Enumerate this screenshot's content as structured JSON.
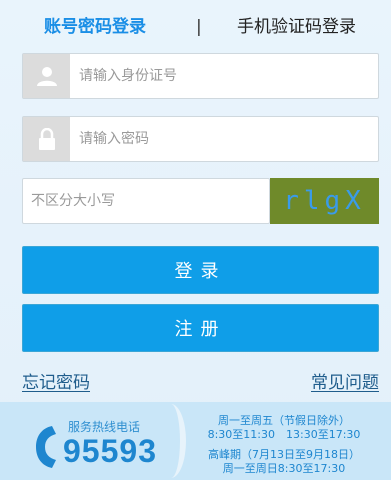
{
  "tabs": {
    "account": "账号密码登录",
    "separator": "|",
    "phone": "手机验证码登录"
  },
  "form": {
    "id_placeholder": "请输入身份证号",
    "password_placeholder": "请输入密码",
    "captcha_placeholder": "不区分大小写",
    "captcha_text": "rlgX"
  },
  "buttons": {
    "login": "登录",
    "register": "注册"
  },
  "links": {
    "forgot": "忘记密码",
    "faq": "常见问题"
  },
  "hotline": {
    "label": "服务热线电话",
    "number": "95593",
    "hours_line1": "周一至周五（节假日除外）",
    "hours_line2": "8:30至11:30　13:30至17:30",
    "hours_line3": "高峰期（7月13日至9月18日）",
    "hours_line4": "周一至周日8:30至17:30"
  },
  "icons": {
    "id_field": "user-icon",
    "password_field": "lock-icon",
    "hotline": "phone-icon"
  },
  "colors": {
    "accent": "#0f9ee8",
    "tab_active": "#1a8ee6",
    "captcha_bg": "#6f8a2a",
    "hotline_text": "#1e86cf"
  }
}
